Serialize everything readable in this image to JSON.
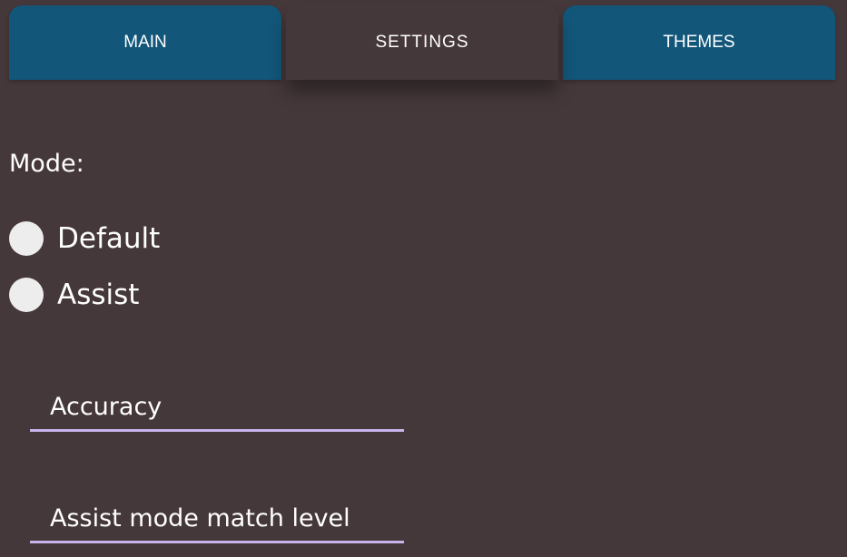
{
  "tabs": {
    "main": "MAIN",
    "settings": "SETTINGS",
    "themes": "THEMES"
  },
  "settings": {
    "mode_label": "Mode:",
    "mode_options": [
      {
        "label": "Default",
        "selected": false
      },
      {
        "label": "Assist",
        "selected": false
      }
    ],
    "fields": [
      {
        "value": "",
        "placeholder": "Accuracy"
      },
      {
        "value": "",
        "placeholder": "Assist mode match level"
      }
    ]
  },
  "colors": {
    "background": "#45383a",
    "tab_blue": "#125679",
    "radio_fill": "#ededed",
    "field_underline": "#c9b3ea",
    "text": "#ffffff"
  }
}
